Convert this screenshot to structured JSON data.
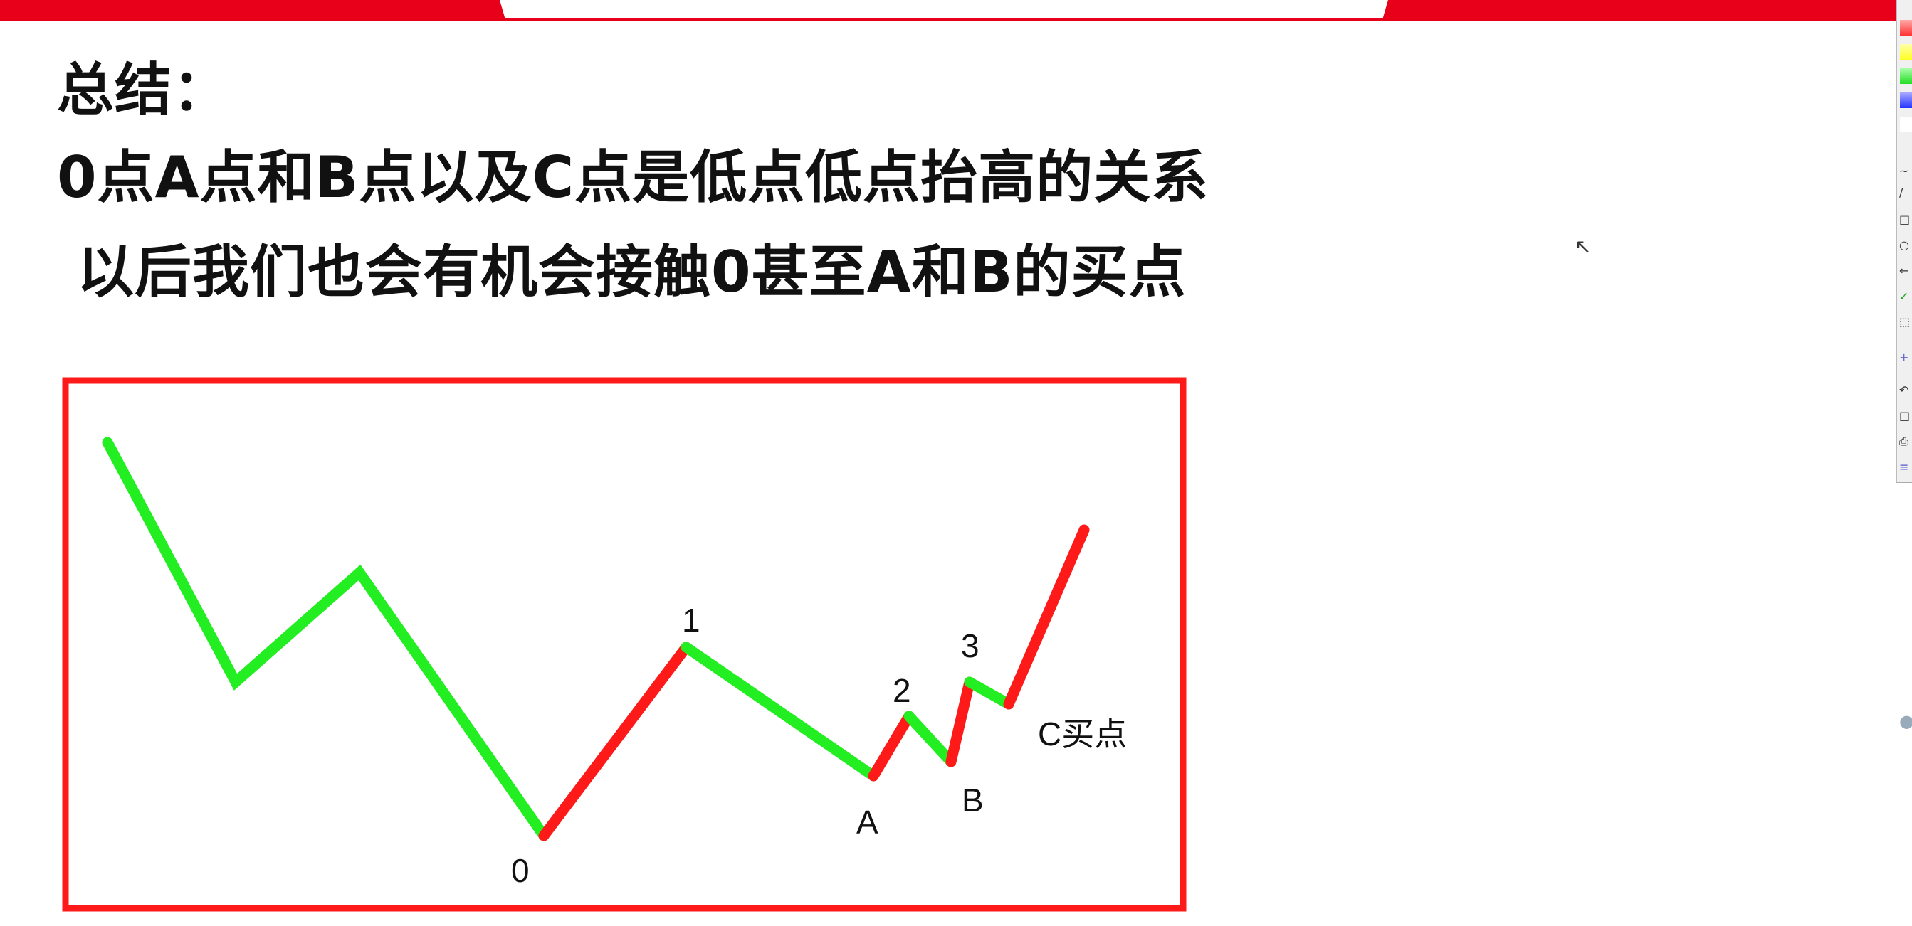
{
  "slide": {
    "heading": "总结：",
    "line1": "0点A点和B点以及C点是低点低点抬高的关系",
    "line2": "以后我们也会有机会接触0甚至A和B的买点"
  },
  "diagram": {
    "labels": {
      "p0": "0",
      "p1": "1",
      "pA": "A",
      "p2": "2",
      "pB": "B",
      "p3": "3",
      "pC": "C买点"
    },
    "colors": {
      "frame": "#ff1a1a",
      "down": "#22ee22",
      "up": "#ff1a1a"
    }
  },
  "toolbar": {
    "colors": [
      "#ff4444",
      "#ffff44",
      "#44ee44",
      "#4455ff",
      "#ffffff"
    ],
    "tools": [
      "freehand-icon",
      "line-icon",
      "rectangle-icon",
      "ellipse-icon",
      "arrow-icon",
      "check-icon",
      "marquee-icon",
      "add-icon",
      "undo-icon",
      "blank-icon",
      "print-icon",
      "menu-icon"
    ]
  }
}
